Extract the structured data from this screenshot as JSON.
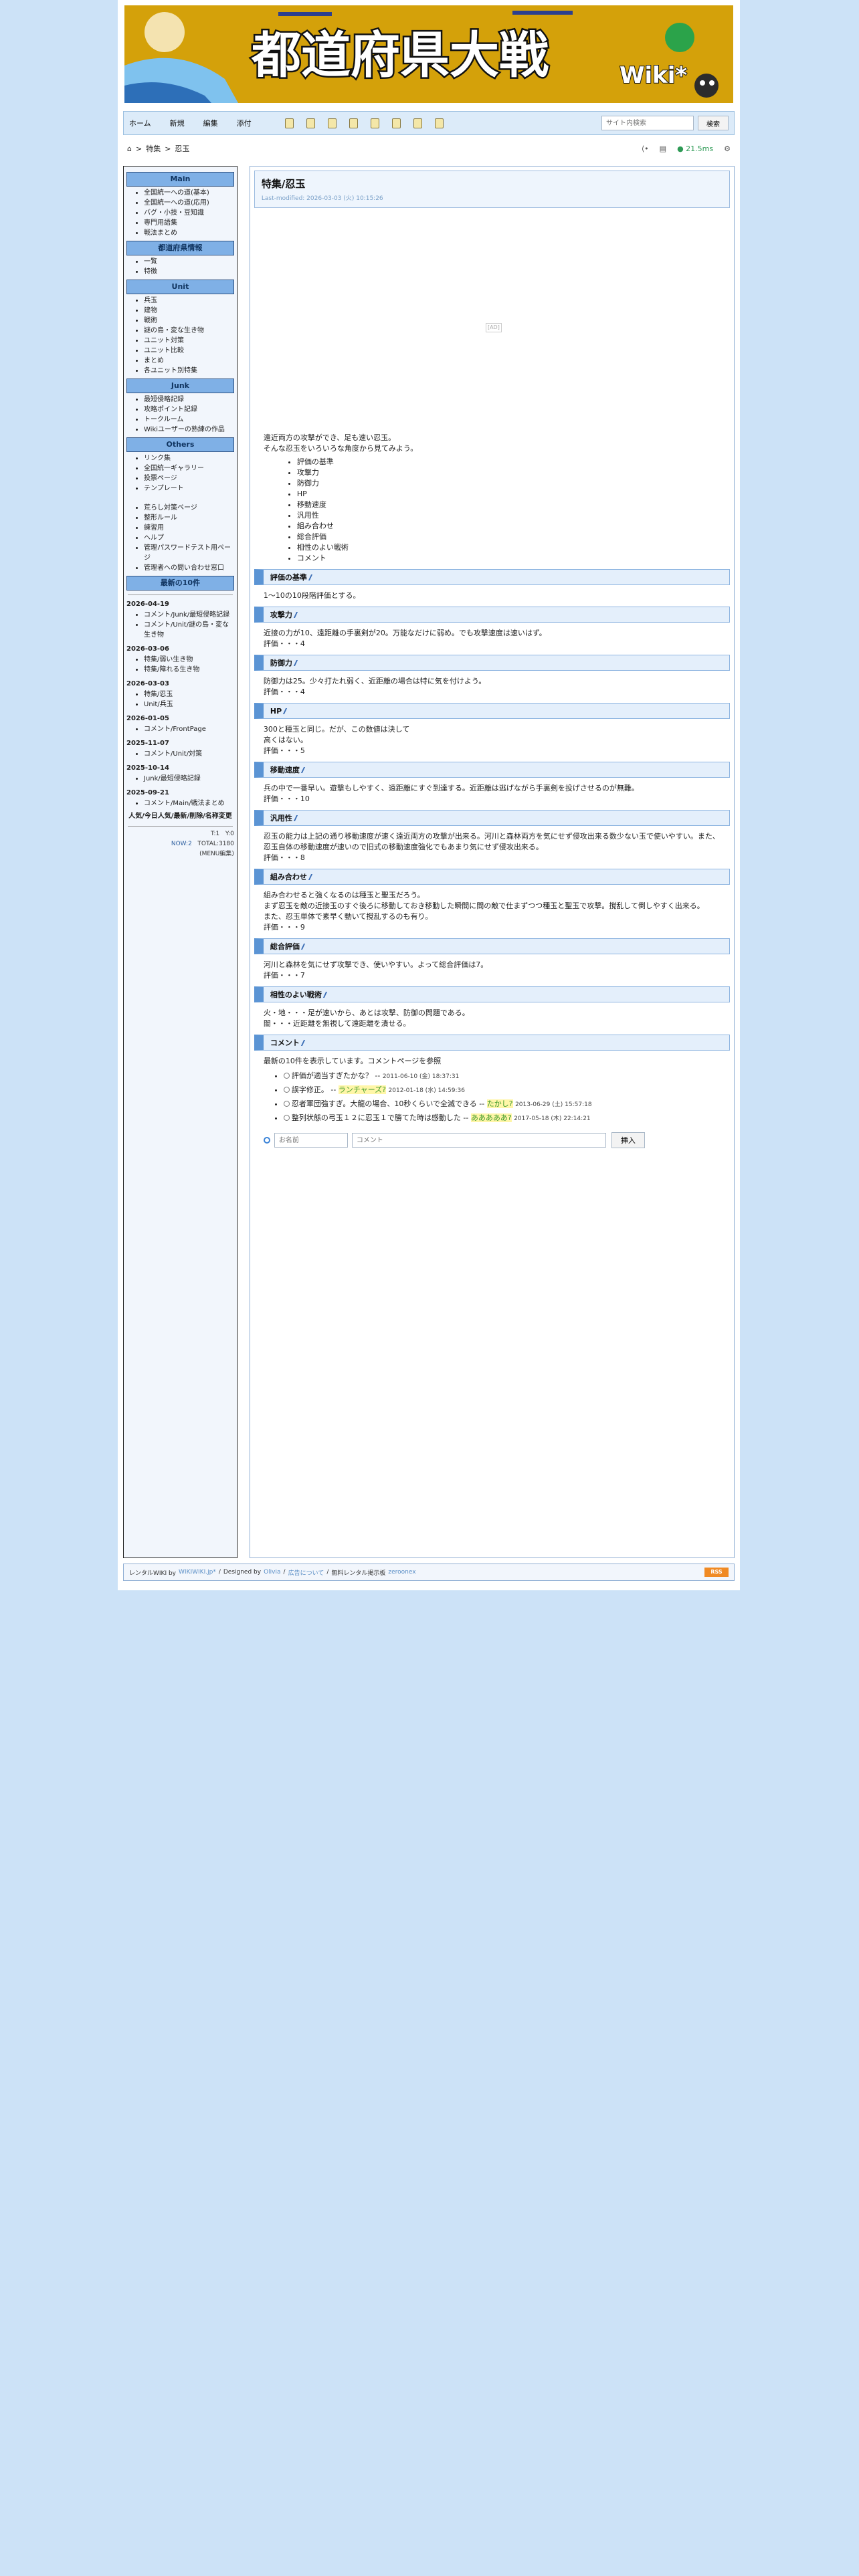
{
  "site": {
    "banner_title": "都道府県大戦",
    "banner_subtitle": "Wiki*",
    "banner_bg": "#d4a10a"
  },
  "navbar": {
    "links": [
      "ホーム",
      "新規",
      "編集",
      "添付"
    ],
    "icons": [
      "new-page-icon",
      "copy-page-icon",
      "diff-icon",
      "backup-icon",
      "attach-icon",
      "rename-icon",
      "list-icon",
      "recent-icon"
    ],
    "search_placeholder": "サイト内検索",
    "search_button": "検索"
  },
  "crumbs": {
    "home_icon": "home-icon",
    "path": [
      "特集",
      "忍玉"
    ],
    "share_icon": "share-icon",
    "history_icon": "history-icon",
    "timing": "21.5ms",
    "gear_icon": "gear-icon"
  },
  "menu": {
    "sections": [
      {
        "title": "Main",
        "items": [
          "全国統一への道(基本)",
          "全国統一への道(応用)",
          "バグ・小技・豆知識",
          "専門用語集",
          "戦法まとめ"
        ]
      },
      {
        "title": "都道府県情報",
        "items": [
          "一覧",
          "特徴"
        ]
      },
      {
        "title": "Unit",
        "items": [
          "兵玉",
          "建物",
          "戦術",
          "謎の島・変な生き物",
          "ユニット対策",
          "ユニット比較",
          "まとめ",
          "各ユニット別特集"
        ]
      },
      {
        "title": "Junk",
        "items": [
          "最短侵略記録",
          "攻略ポイント記録",
          "トークルーム",
          "Wikiユーザーの熟練の作品"
        ]
      },
      {
        "title": "Others",
        "items": [
          "リンク集",
          "全国統一ギャラリー",
          "投票ページ",
          "テンプレート"
        ]
      }
    ],
    "extra_items": [
      "荒らし対策ページ",
      "整形ルール",
      "練習用",
      "ヘルプ",
      "管理パスワードテスト用ページ",
      "管理者への問い合わせ窓口"
    ],
    "recent_title": "最新の10件",
    "recent": [
      {
        "date": "2026-04-19",
        "items": [
          "コメント/Junk/最短侵略記録",
          "コメント/Unit/謎の島・変な生き物"
        ]
      },
      {
        "date": "2026-03-06",
        "items": [
          "特集/弱い生き物",
          "特集/障れる生き物"
        ]
      },
      {
        "date": "2026-03-03",
        "items": [
          "特集/忍玉",
          "Unit/兵玉"
        ]
      },
      {
        "date": "2026-01-05",
        "items": [
          "コメント/FrontPage"
        ]
      },
      {
        "date": "2025-11-07",
        "items": [
          "コメント/Unit/対策"
        ]
      },
      {
        "date": "2025-10-14",
        "items": [
          "Junk/最短侵略記録"
        ]
      },
      {
        "date": "2025-09-21",
        "items": [
          "コメント/Main/戦法まとめ"
        ]
      }
    ],
    "popular_title": "人気/今日人気/最新/削除/名称変更",
    "stats": {
      "t1": "T:1",
      "y0": "Y:0",
      "now": "NOW:2",
      "total": "TOTAL:3180",
      "edit": "(MENU編集)"
    }
  },
  "page": {
    "title": "特集/忍玉",
    "last_modified": "Last-modified: 2026-03-03 (火) 10:15:26",
    "ad_label": "[AD]",
    "intro": [
      "遠近両方の攻撃ができ、足も速い忍玉。",
      "そんな忍玉をいろいろな角度から見てみよう。"
    ],
    "toc": [
      "評価の基準",
      "攻撃力",
      "防御力",
      "HP",
      "移動速度",
      "汎用性",
      "組み合わせ",
      "総合評価",
      "相性のよい戦術",
      "コメント"
    ],
    "sections": [
      {
        "heading": "評価の基準",
        "lines": [
          "1〜10の10段階評価とする。"
        ]
      },
      {
        "heading": "攻撃力",
        "lines": [
          "近接の力が10、遠距離の手裏剣が20。万能なだけに弱め。でも攻撃速度は速いはず。",
          "評価・・・4"
        ]
      },
      {
        "heading": "防御力",
        "lines": [
          "防御力は25。少々打たれ弱く、近距離の場合は特に気を付けよう。",
          "評価・・・4"
        ]
      },
      {
        "heading": "HP",
        "lines": [
          "300と種玉と同じ。だが、この数値は決して",
          "高くはない。",
          "評価・・・5"
        ]
      },
      {
        "heading": "移動速度",
        "lines": [
          "兵の中で一番早い。遊撃もしやすく、遠距離にすぐ到達する。近距離は逃げながら手裏剣を投げさせるのが無難。",
          "評価・・・10"
        ]
      },
      {
        "heading": "汎用性",
        "lines": [
          "忍玉の能力は上記の通り移動速度が速く遠近両方の攻撃が出来る。河川と森林両方を気にせず侵攻出来る数少ない玉で使いやすい。また、忍玉自体の移動速度が速いので旧式の移動速度強化でもあまり気にせず侵攻出来る。",
          "評価・・・8"
        ]
      },
      {
        "heading": "組み合わせ",
        "lines": [
          "組み合わせると強くなるのは種玉と聖玉だろう。",
          "まず忍玉を敵の近接玉のすぐ後ろに移動しておき移動した瞬間に間の敵で仕まずつつ種玉と聖玉で攻撃。撹乱して倒しやすく出来る。",
          "また、忍玉単体で素早く動いて撹乱するのも有り。",
          "評価・・・9"
        ]
      },
      {
        "heading": "総合評価",
        "lines": [
          "河川と森林を気にせず攻撃でき、使いやすい。よって総合評価は7。",
          "評価・・・7"
        ]
      },
      {
        "heading": "相性のよい戦術",
        "lines": [
          "火・地・・・足が速いから、あとは攻撃、防御の問題である。",
          "闇・・・近距離を無視して遠距離を潰せる。"
        ]
      }
    ],
    "comment": {
      "heading": "コメント",
      "note": "最新の10件を表示しています。コメントページを参照",
      "items": [
        {
          "text": "評価が適当すぎたかな？ --",
          "name": "",
          "date": "2011-06-10 (金) 18:37:31"
        },
        {
          "text": "誤字修正。 --",
          "name": "ランチャーズ?",
          "date": "2012-01-18 (水) 14:59:36"
        },
        {
          "text": "忍者軍団強すぎ。大龍の場合、10秒くらいで全滅できる --",
          "name": "たかし?",
          "date": "2013-06-29 (土) 15:57:18"
        },
        {
          "text": "整列状態の弓玉１２に忍玉１で勝てた時は感動した --",
          "name": "あああああ?",
          "date": "2017-05-18 (木) 22:14:21"
        }
      ],
      "name_placeholder": "お名前",
      "comment_placeholder": "コメント",
      "submit": "挿入"
    }
  },
  "footer": {
    "prefix": "レンタルWIKI by",
    "host": "WIKIWIKI.jp*",
    "designed": "Designed by",
    "designer": "Olivia",
    "ad": "広告について",
    "rental": "無料レンタル掲示板",
    "zeroone": "zeroonex",
    "rss": "RSS"
  }
}
